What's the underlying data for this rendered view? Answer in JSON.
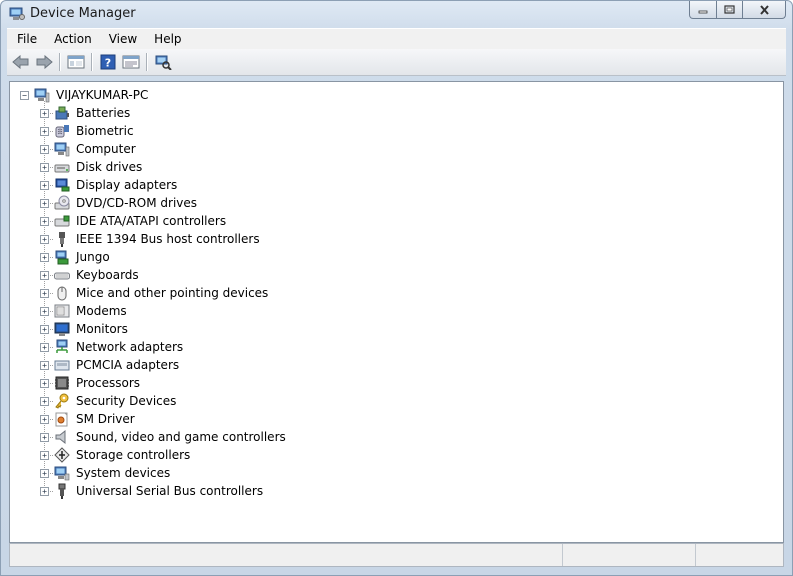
{
  "window": {
    "title": "Device Manager"
  },
  "menubar": {
    "items": [
      "File",
      "Action",
      "View",
      "Help"
    ]
  },
  "toolbar": {
    "buttons": [
      "back-arrow-icon",
      "forward-arrow-icon",
      "console-tree-icon",
      "help-icon",
      "properties-icon",
      "scan-hardware-icon"
    ]
  },
  "tree": {
    "root": "VIJAYKUMAR-PC",
    "root_icon": "computer-icon",
    "categories": [
      {
        "label": "Batteries",
        "icon": "battery-icon"
      },
      {
        "label": "Biometric",
        "icon": "biometric-icon"
      },
      {
        "label": "Computer",
        "icon": "computer-icon"
      },
      {
        "label": "Disk drives",
        "icon": "disk-drive-icon"
      },
      {
        "label": "Display adapters",
        "icon": "display-adapter-icon"
      },
      {
        "label": "DVD/CD-ROM drives",
        "icon": "dvd-drive-icon"
      },
      {
        "label": "IDE ATA/ATAPI controllers",
        "icon": "ide-controller-icon"
      },
      {
        "label": "IEEE 1394 Bus host controllers",
        "icon": "ieee1394-icon"
      },
      {
        "label": "Jungo",
        "icon": "jungo-icon"
      },
      {
        "label": "Keyboards",
        "icon": "keyboard-icon"
      },
      {
        "label": "Mice and other pointing devices",
        "icon": "mouse-icon"
      },
      {
        "label": "Modems",
        "icon": "modem-icon"
      },
      {
        "label": "Monitors",
        "icon": "monitor-icon"
      },
      {
        "label": "Network adapters",
        "icon": "network-adapter-icon"
      },
      {
        "label": "PCMCIA adapters",
        "icon": "pcmcia-icon"
      },
      {
        "label": "Processors",
        "icon": "processor-icon"
      },
      {
        "label": "Security Devices",
        "icon": "security-device-icon"
      },
      {
        "label": "SM Driver",
        "icon": "sm-driver-icon"
      },
      {
        "label": "Sound, video and game controllers",
        "icon": "speaker-icon"
      },
      {
        "label": "Storage controllers",
        "icon": "storage-controller-icon"
      },
      {
        "label": "System devices",
        "icon": "system-device-icon"
      },
      {
        "label": "Universal Serial Bus controllers",
        "icon": "usb-icon"
      }
    ]
  }
}
